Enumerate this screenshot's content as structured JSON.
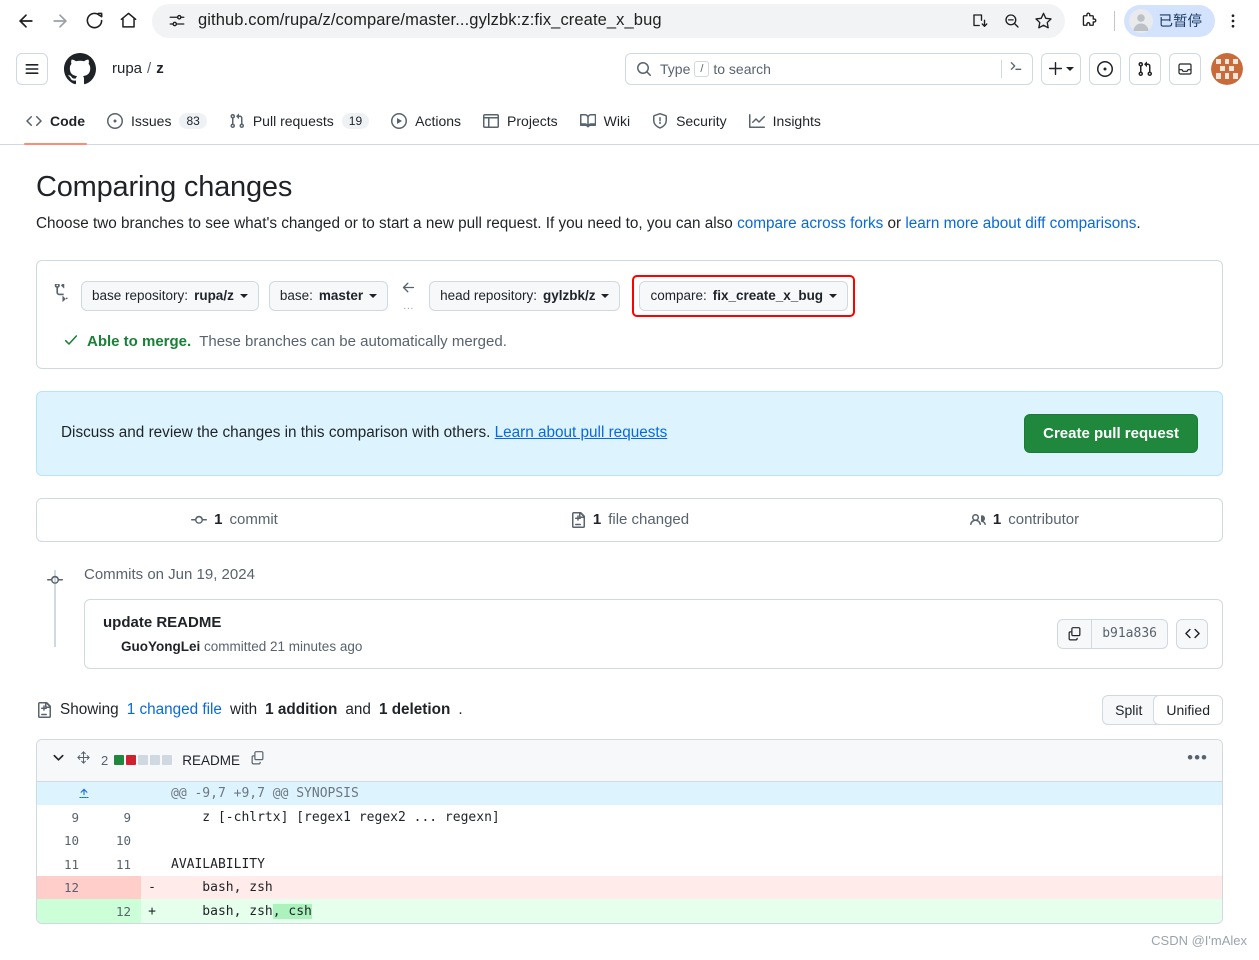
{
  "browser": {
    "url": "github.com/rupa/z/compare/master...gylzbk:z:fix_create_x_bug",
    "back_icon": "back-arrow-icon",
    "forward_icon": "forward-arrow-icon",
    "reload_icon": "reload-icon",
    "home_icon": "home-icon",
    "site_info_icon": "site-settings-icon",
    "install_icon": "install-app-icon",
    "zoom_icon": "zoom-out-icon",
    "bookmark_icon": "bookmark-star-icon",
    "extensions_icon": "extensions-puzzle-icon",
    "profile_label": "已暂停",
    "menu_icon": "chrome-menu-icon"
  },
  "gh_header": {
    "hamburger_icon": "hamburger-menu-icon",
    "logo_icon": "github-logo-icon",
    "owner": "rupa",
    "separator": "/",
    "repo": "z",
    "search_placeholder": "Type",
    "search_key": "/",
    "search_suffix": "to search",
    "terminal_icon": "terminal-prompt-icon",
    "create_new_icon": "plus-icon",
    "issues_icon": "issue-opened-icon",
    "pulls_icon": "git-pull-request-icon",
    "inbox_icon": "inbox-icon",
    "avatar_icon": "user-avatar-icon"
  },
  "repo_nav": {
    "tabs": [
      {
        "label": "Code",
        "icon": "code-icon",
        "count": "",
        "active": true
      },
      {
        "label": "Issues",
        "icon": "issue-icon",
        "count": "83",
        "active": false
      },
      {
        "label": "Pull requests",
        "icon": "pull-request-icon",
        "count": "19",
        "active": false
      },
      {
        "label": "Actions",
        "icon": "play-icon",
        "count": "",
        "active": false
      },
      {
        "label": "Projects",
        "icon": "table-icon",
        "count": "",
        "active": false
      },
      {
        "label": "Wiki",
        "icon": "book-icon",
        "count": "",
        "active": false
      },
      {
        "label": "Security",
        "icon": "shield-icon",
        "count": "",
        "active": false
      },
      {
        "label": "Insights",
        "icon": "graph-icon",
        "count": "",
        "active": false
      }
    ]
  },
  "main": {
    "title": "Comparing changes",
    "subtitle_1": "Choose two branches to see what's changed or to start a new pull request. If you need to, you can also ",
    "subtitle_link_1": "compare across forks",
    "subtitle_2": " or ",
    "subtitle_link_2": "learn more about diff comparisons",
    "subtitle_3": "."
  },
  "branch_selector": {
    "compare_icon": "compare-branches-icon",
    "base_repo_label": "base repository:",
    "base_repo_value": "rupa/z",
    "base_label": "base:",
    "base_value": "master",
    "arrow_icon": "left-arrow-icon",
    "ellipsis": "...",
    "head_repo_label": "head repository:",
    "head_repo_value": "gylzbk/z",
    "compare_label": "compare:",
    "compare_value": "fix_create_x_bug",
    "highlight_color": "#ff0000",
    "merge_check_icon": "check-icon",
    "merge_status_bold": "Able to merge.",
    "merge_status_rest": "These branches can be automatically merged."
  },
  "discuss": {
    "text": "Discuss and review the changes in this comparison with others. ",
    "link": "Learn about pull requests",
    "button": "Create pull request",
    "button_color": "#1f883d",
    "background": "#ddf4ff"
  },
  "stats": [
    {
      "icon": "commit-icon",
      "count": "1",
      "label": "commit"
    },
    {
      "icon": "file-diff-icon",
      "count": "1",
      "label": "file changed"
    },
    {
      "icon": "people-icon",
      "count": "1",
      "label": "contributor"
    }
  ],
  "commits": {
    "date_heading": "Commits on Jun 19, 2024",
    "node_icon": "commit-node-icon",
    "message": "update README",
    "author": "GuoYongLei",
    "meta_rest": "committed 21 minutes ago",
    "copy_icon": "copy-icon",
    "sha": "b91a836",
    "code_icon": "browse-code-icon"
  },
  "showing": {
    "file_icon": "file-diff-icon",
    "prefix": "Showing ",
    "link": "1 changed file",
    "middle": " with ",
    "additions": "1 addition",
    "conj": " and ",
    "deletions": "1 deletion",
    "suffix": ".",
    "view_split": "Split",
    "view_unified": "Unified"
  },
  "diff": {
    "collapse_icon": "chevron-down-icon",
    "expand_icon": "expand-diff-icon",
    "stat_count": "2",
    "blocks": [
      "add",
      "del",
      "none",
      "none",
      "none"
    ],
    "filename": "README",
    "copy_path_icon": "copy-path-icon",
    "menu_icon": "kebab-menu-icon",
    "expand_row_icon": "expand-up-icon",
    "rows": [
      {
        "type": "hunk",
        "old": "",
        "new": "",
        "marker": "",
        "code": "@@ -9,7 +9,7 @@ SYNOPSIS"
      },
      {
        "type": "context",
        "old": "9",
        "new": "9",
        "marker": "",
        "code": "    z [-chlrtx] [regex1 regex2 ... regexn]"
      },
      {
        "type": "context",
        "old": "10",
        "new": "10",
        "marker": "",
        "code": ""
      },
      {
        "type": "context",
        "old": "11",
        "new": "11",
        "marker": "",
        "code": "AVAILABILITY"
      },
      {
        "type": "del",
        "old": "12",
        "new": "",
        "marker": "-",
        "code": "    bash, zsh"
      },
      {
        "type": "add",
        "old": "",
        "new": "12",
        "marker": "+",
        "code": "    bash, zsh",
        "code_highlight": ", csh"
      }
    ]
  },
  "watermark": "CSDN @I'mAlex"
}
